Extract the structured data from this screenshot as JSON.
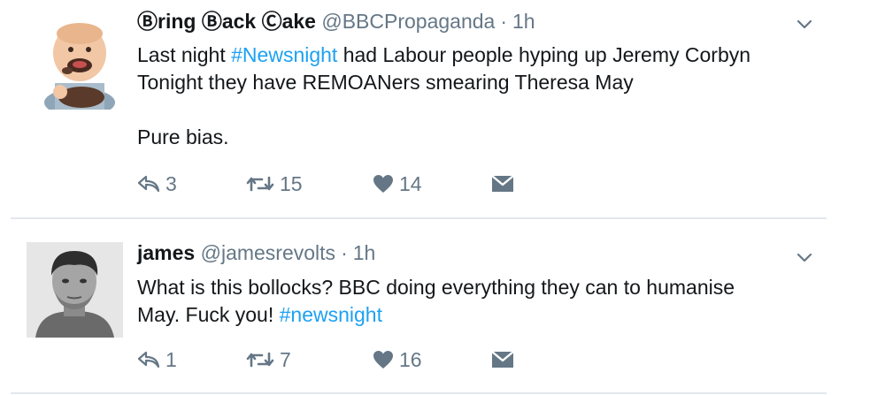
{
  "tweets": [
    {
      "display_name": "Ⓑring Ⓑack Ⓒake",
      "handle": "@BBCPropaganda",
      "separator": "·",
      "time": "1h",
      "lines": [
        {
          "parts": [
            "Last night ",
            "#Newsnight",
            " had Labour people hyping up Jeremy Corbyn"
          ]
        },
        {
          "parts": [
            "Tonight they have REMOANers smearing Theresa May"
          ]
        },
        {
          "parts": [
            "Pure bias."
          ]
        }
      ],
      "replies": "3",
      "retweets": "15",
      "likes": "14",
      "avatar_icon": "baby-cake-avatar"
    },
    {
      "display_name": "james",
      "handle": "@jamesrevolts",
      "separator": "·",
      "time": "1h",
      "lines": [
        {
          "parts": [
            "What is this bollocks? BBC doing everything they can to humanise"
          ]
        },
        {
          "parts": [
            "May. Fuck you! ",
            "#newsnight"
          ]
        }
      ],
      "replies": "1",
      "retweets": "7",
      "likes": "16",
      "avatar_icon": "man-portrait-avatar"
    }
  ],
  "icons": {
    "reply": "reply-icon",
    "retweet": "retweet-icon",
    "like": "heart-icon",
    "dm": "envelope-icon",
    "more": "chevron-down-icon"
  },
  "colors": {
    "text": "#14171a",
    "muted": "#657786",
    "hashtag": "#1da1f2",
    "divider": "#e1e8ed"
  }
}
